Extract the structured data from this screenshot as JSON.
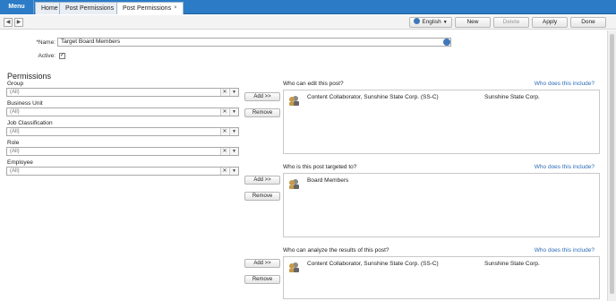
{
  "tabs": {
    "menu": "Menu",
    "home": "Home",
    "tab1": "Post Permissions",
    "tab2": "Post Permissions",
    "close": "×"
  },
  "toolbar": {
    "back": "◀",
    "forward": "▶",
    "language": "English",
    "new": "New",
    "delete": "Delete",
    "apply": "Apply",
    "done": "Done"
  },
  "form": {
    "name_label": "*Name:",
    "name_value": "Target Board Members",
    "active_label": "Active:",
    "active_checked": "✓"
  },
  "permissions": {
    "title": "Permissions",
    "fields": [
      {
        "label": "Group",
        "value": "(All)"
      },
      {
        "label": "Business Unit",
        "value": "(All)"
      },
      {
        "label": "Job Classification",
        "value": "(All)"
      },
      {
        "label": "Role",
        "value": "(All)"
      },
      {
        "label": "Employee",
        "value": "(All)"
      }
    ],
    "clear": "✕",
    "caret": "▼"
  },
  "sections": [
    {
      "title": "Who can edit this post?",
      "link": "Who does this include?",
      "add": "Add >>",
      "remove": "Remove",
      "rows": [
        {
          "name": "Content Collaborator, Sunshine State Corp. (SS-C)",
          "org": "Sunshine State Corp."
        }
      ]
    },
    {
      "title": "Who is this post targeted to?",
      "link": "Who does this include?",
      "add": "Add >>",
      "remove": "Remove",
      "rows": [
        {
          "name": "Board Members",
          "org": ""
        }
      ]
    },
    {
      "title": "Who can analyze the results of this post?",
      "link": "Who does this include?",
      "add": "Add >>",
      "remove": "Remove",
      "rows": [
        {
          "name": "Content Collaborator, Sunshine State Corp. (SS-C)",
          "org": "Sunshine State Corp."
        }
      ]
    }
  ],
  "colors": {
    "topbar": "#2b7bc6",
    "link": "#2b6cb8"
  }
}
